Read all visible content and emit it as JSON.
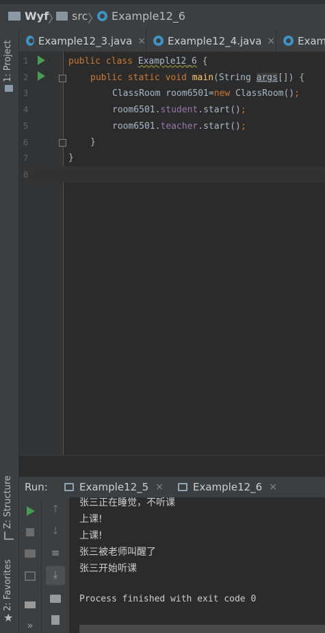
{
  "breadcrumb": {
    "project": "Wyf",
    "folder": "src",
    "file": "Example12_6"
  },
  "left_strip": {
    "project_label": "1: Project",
    "structure_label": "Z: Structure",
    "favorites_label": "2: Favorites"
  },
  "tabs": [
    {
      "label": "Example12_3.java",
      "close": "×"
    },
    {
      "label": "Example12_4.java",
      "close": "×"
    },
    {
      "label": "Exam"
    }
  ],
  "editor": {
    "line_numbers": [
      "1",
      "2",
      "3",
      "4",
      "5",
      "6",
      "7",
      "8"
    ],
    "lines": [
      {
        "kw": "public class ",
        "name": "Example12_6",
        "rest": " {"
      },
      {
        "kw": "public static void ",
        "name": "main",
        "pre": "(String ",
        "arg": "args",
        "rest": "[]) {"
      },
      {
        "type": "ClassRoom room6501=",
        "kw": "new",
        "rest": " ClassRoom()",
        "semi": ";"
      },
      {
        "obj": "room6501.",
        "field": "student",
        "rest": ".start()",
        "semi": ";"
      },
      {
        "obj": "room6501.",
        "field": "teacher",
        "rest": ".start()",
        "semi": ";"
      },
      {
        "text": "}"
      },
      {
        "text": "}"
      }
    ]
  },
  "run": {
    "label": "Run:",
    "tabs": [
      {
        "label": "Example12_5",
        "close": "×"
      },
      {
        "label": "Example12_6",
        "close": "×"
      }
    ]
  },
  "console": {
    "lines": [
      "张三正在睡觉，不听课",
      "上课!",
      "上课!",
      "张三被老师叫醒了",
      "张三开始听课"
    ],
    "exit": "Process finished with exit code 0"
  },
  "colors": {
    "keyword": "#cc7832",
    "function": "#ffc66d",
    "field": "#9876aa",
    "run_green": "#499c54",
    "file_icon": "#3d93c4"
  }
}
